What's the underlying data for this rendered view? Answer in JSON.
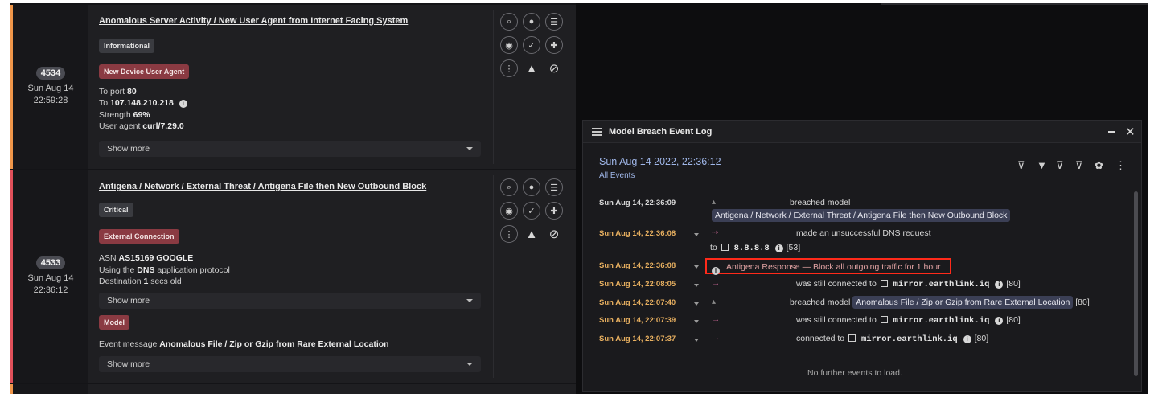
{
  "breaches": [
    {
      "id": "4534",
      "date": "Sun Aug 14",
      "time": "22:59:28",
      "accent": "#f0964a",
      "title": "Anomalous Server Activity / New User Agent from Internet Facing System",
      "severity": "Informational",
      "category": "New Device User Agent",
      "details": [
        {
          "label": "To port",
          "value": "80"
        },
        {
          "label": "To",
          "value": "107.148.210.218"
        },
        {
          "label": "Strength",
          "value": "69%"
        },
        {
          "label": "User agent",
          "value": "curl/7.29.0"
        }
      ],
      "show_more": "Show more"
    },
    {
      "id": "4533",
      "date": "Sun Aug 14",
      "time": "22:36:12",
      "accent": "#e0505a",
      "title": "Antigena / Network / External Threat / Antigena File then New Outbound Block",
      "severity": "Critical",
      "category": "External Connection",
      "details": [
        {
          "label": "ASN",
          "value": "AS15169 GOOGLE"
        },
        {
          "label": "Using the",
          "value": "DNS",
          "suffix": "application protocol"
        },
        {
          "label": "Destination",
          "value": "1",
          "suffix": "secs old"
        }
      ],
      "show_more": "Show more",
      "model_tag": "Model",
      "event_message_label": "Event message",
      "event_message_value": "Anomalous File / Zip or Gzip from Rare External Location",
      "show_more_2": "Show more"
    }
  ],
  "icons": {
    "search": "search-icon",
    "comment": "comment-icon",
    "list": "list-icon",
    "watch": "eye-icon",
    "ack": "check-icon",
    "pin": "pin-icon",
    "more": "more-vertical-icon",
    "alert": "warning-icon",
    "hide": "eye-off-icon"
  },
  "event_log": {
    "title": "Model Breach Event Log",
    "date": "Sun Aug 14 2022, 22:36:12",
    "filter_label": "All Events",
    "no_more": "No further events to load.",
    "events": [
      {
        "time": "Sun Aug 14, 22:36:09",
        "time_color": "#d8d8d8",
        "text": "breached model",
        "pill": "Antigena / Network / External Threat / Antigena File then New Outbound Block"
      },
      {
        "time": "Sun Aug 14, 22:36:08",
        "time_color": "#e8b060",
        "text": "made an unsuccessful DNS request",
        "to": "to",
        "host": "8.8.8.8",
        "count": "[53]"
      },
      {
        "time": "Sun Aug 14, 22:36:08",
        "time_color": "#e8b060",
        "response_label": "Antigena Response",
        "response_dash": "—",
        "response_action": "Block all outgoing traffic for 1 hour"
      },
      {
        "time": "Sun Aug 14, 22:08:05",
        "time_color": "#e8b060",
        "text": "was still connected to",
        "host": "mirror.earthlink.iq",
        "count": "[80]"
      },
      {
        "time": "Sun Aug 14, 22:07:40",
        "time_color": "#e8b060",
        "text": "breached model",
        "pill": "Anomalous File / Zip or Gzip from Rare External Location",
        "count": "[80]"
      },
      {
        "time": "Sun Aug 14, 22:07:39",
        "time_color": "#e8b060",
        "text": "was still connected to",
        "host": "mirror.earthlink.iq",
        "count": "[80]"
      },
      {
        "time": "Sun Aug 14, 22:07:37",
        "time_color": "#e8b060",
        "text": "connected to",
        "host": "mirror.earthlink.iq",
        "count": "[80]"
      }
    ]
  }
}
